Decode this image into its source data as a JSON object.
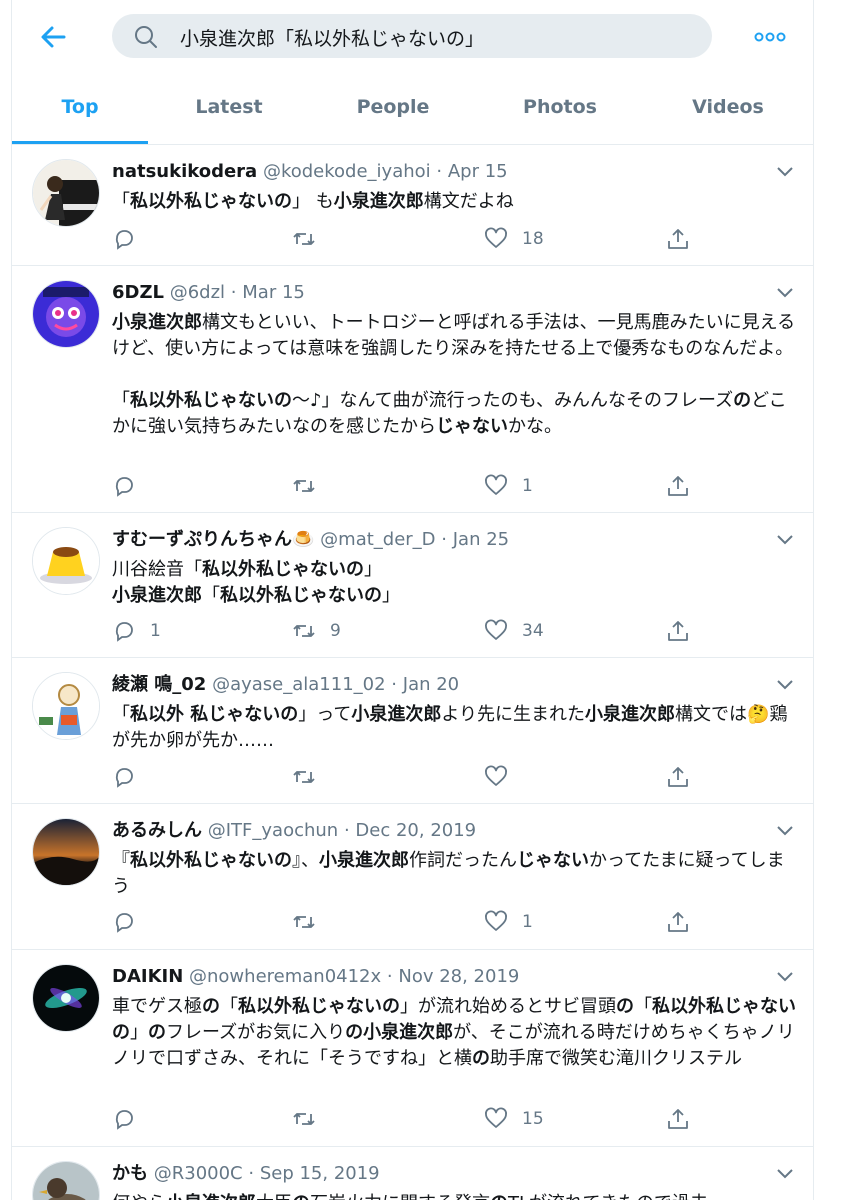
{
  "header": {
    "search_value": "小泉進次郎「私以外私じゃないの」"
  },
  "tabs": [
    {
      "label": "Top"
    },
    {
      "label": "Latest"
    },
    {
      "label": "People"
    },
    {
      "label": "Photos"
    },
    {
      "label": "Videos"
    }
  ],
  "colors": {
    "accent": "#1da1f2",
    "muted": "#657786",
    "divider": "#e6ecf0"
  },
  "tweets": [
    {
      "name": "natsukikodera",
      "handle": "@kodekode_iyahoi",
      "date": "Apr 15",
      "body_html": "<p>「<b>私以外私じゃないの</b>」 も<b>小泉進次郎</b>構文だよね</p>",
      "replies": "",
      "retweets": "",
      "likes": "18"
    },
    {
      "name": "6DZL",
      "handle": "@6dzl",
      "date": "Mar 15",
      "body_html": "<p><b>小泉進次郎</b>構文もといい、トートロジーと呼ばれる手法は、一見馬鹿みたいに見えるけど、使い方によっては意味を強調したり深みを持たせる上で優秀なものなんだよ。</p><p>&nbsp;</p><p>「<b>私以外私じゃないの</b>〜♪」なんて曲が流行ったのも、みんんなそのフレーズ<b>の</b>どこかに強い気持ちみたいなのを感じたから<b>じゃない</b>かな。</p>",
      "replies": "",
      "retweets": "",
      "likes": "1"
    },
    {
      "name": "すむーずぷりんちゃん🍮",
      "handle": "@mat_der_D",
      "date": "Jan 25",
      "body_html": "<p>川谷絵音「<b>私以外私じゃないの</b>」</p><p><b>小泉進次郎</b>「<b>私以外私じゃないの</b>」</p>",
      "replies": "1",
      "retweets": "9",
      "likes": "34"
    },
    {
      "name": "綾瀬 鳴_02",
      "handle": "@ayase_ala111_02",
      "date": "Jan 20",
      "body_html": "<p>「<b>私以外 私じゃないの</b>」って<b>小泉進次郎</b>より先に生まれた<b>小泉進次郎</b>構文では🤔鶏が先か卵が先か……</p>",
      "replies": "",
      "retweets": "",
      "likes": ""
    },
    {
      "name": "あるみしん",
      "handle": "@ITF_yaochun",
      "date": "Dec 20, 2019",
      "body_html": "<p>『<b>私以外私じゃないの</b>』、<b>小泉進次郎</b>作詞だったん<b>じゃない</b>かってたまに疑ってしまう</p>",
      "replies": "",
      "retweets": "",
      "likes": "1"
    },
    {
      "name": "DAIKIN",
      "handle": "@nowhereman0412x",
      "date": "Nov 28, 2019",
      "body_html": "<p>車でゲス極<b>の</b>「<b>私以外私じゃないの</b>」が流れ始めるとサビ冒頭<b>の</b>「<b>私以外私じゃないの</b>」<b>の</b>フレーズがお気に入り<b>の小泉進次郎</b>が、そこが流れる時だけめちゃくちゃノリノリで口ずさみ、それに「そうですね」と横<b>の</b>助手席で微笑む滝川クリステル</p>",
      "replies": "",
      "retweets": "",
      "likes": "15"
    },
    {
      "name": "かも",
      "handle": "@R3000C",
      "date": "Sep 15, 2019",
      "body_html": "<p>何やら<b>小泉進次郎</b>大臣<b>の</b>石炭火力に関する発言<b>の</b>TLが流れてきたので過去</p>",
      "replies": "",
      "retweets": "",
      "likes": ""
    }
  ]
}
